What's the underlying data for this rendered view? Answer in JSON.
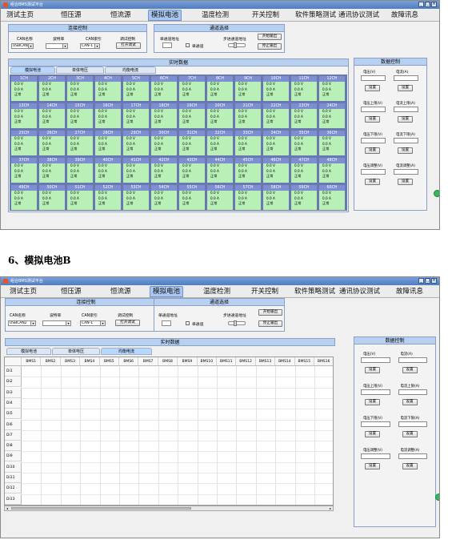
{
  "window": {
    "title": "组合BMS测试平台",
    "buttons": [
      "_",
      "□",
      "×"
    ]
  },
  "nav": [
    "测试主页",
    "恒压源",
    "恒流源",
    "模拟电池",
    "温度检测",
    "开关控制",
    "软件策略测试",
    "通讯协议测试",
    "故障讯息"
  ],
  "conn": {
    "title": "连接控制",
    "can_name_label": "CAN名称",
    "can_name_value": "USBCAN2",
    "baud_label": "波特率",
    "baud_value": "",
    "can_index_label": "CAN索引",
    "can_index_value": "CAN-1",
    "debug_label": "调试控制",
    "open_debug_button": "打开调试"
  },
  "channel": {
    "title": "通道选择",
    "single_addr_label": "单通道地址",
    "step_addr_label": "步进通道地址",
    "single_channel_checkbox": "单通道",
    "start_output_button": "开始输出",
    "stop_output_button": "停止输出"
  },
  "realtime": {
    "title": "实时数据",
    "tabs": [
      "模拟电池",
      "单体电压",
      "均衡电流"
    ],
    "channels": [
      "1CH",
      "2CH",
      "3CH",
      "4CH",
      "5CH",
      "6CH",
      "7CH",
      "8CH",
      "9CH",
      "10CH",
      "11CH",
      "12CH",
      "13CH",
      "14CH",
      "15CH",
      "16CH",
      "17CH",
      "18CH",
      "19CH",
      "20CH",
      "21CH",
      "22CH",
      "23CH",
      "24CH",
      "25CH",
      "26CH",
      "27CH",
      "28CH",
      "29CH",
      "30CH",
      "31CH",
      "32CH",
      "33CH",
      "34CH",
      "35CH",
      "36CH",
      "37CH",
      "38CH",
      "39CH",
      "40CH",
      "41CH",
      "42CH",
      "43CH",
      "44CH",
      "45CH",
      "46CH",
      "47CH",
      "48CH",
      "49CH",
      "50CH",
      "51CH",
      "52CH",
      "53CH",
      "54CH",
      "55CH",
      "56CH",
      "57CH",
      "58CH",
      "59CH",
      "60CH"
    ],
    "voltage": "0.0 V",
    "current": "0.0 A",
    "status": "正常"
  },
  "dataControl": {
    "title": "数据控制",
    "set_button": "设置",
    "labels": [
      "电压(V)",
      "电流(A)",
      "电压上限(V)",
      "电流上限(A)",
      "电压下限(V)",
      "电流下限(A)",
      "电压调整(V)",
      "电流调整(A)"
    ]
  },
  "heading": {
    "number": "6、",
    "text": "模拟电池B"
  },
  "table": {
    "columns": [
      "",
      "BMS1",
      "BMS2",
      "BMS3",
      "BMS4",
      "BMS5",
      "BMS6",
      "BMS7",
      "BMS8",
      "BMS9",
      "BMS10",
      "BMS11",
      "BMS12",
      "BMS13",
      "BMS14",
      "BMS15",
      "BMS16"
    ],
    "rows": [
      "Di1",
      "Di2",
      "Di3",
      "Di4",
      "Di5",
      "Di6",
      "Di7",
      "Di8",
      "Di9",
      "Di10",
      "Di11",
      "Di12",
      "Di13"
    ]
  }
}
